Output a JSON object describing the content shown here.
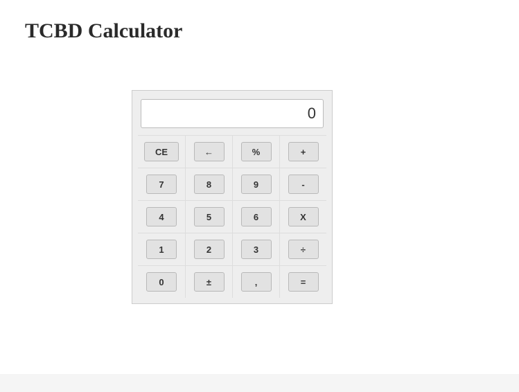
{
  "title": "TCBD Calculator",
  "calculator": {
    "display_value": "0",
    "buttons": {
      "ce": "CE",
      "back": "←",
      "percent": "%",
      "plus": "+",
      "seven": "7",
      "eight": "8",
      "nine": "9",
      "minus": "-",
      "four": "4",
      "five": "5",
      "six": "6",
      "multiply": "X",
      "one": "1",
      "two": "2",
      "three": "3",
      "divide": "÷",
      "zero": "0",
      "plusminus": "±",
      "decimal": ",",
      "equals": "="
    }
  }
}
